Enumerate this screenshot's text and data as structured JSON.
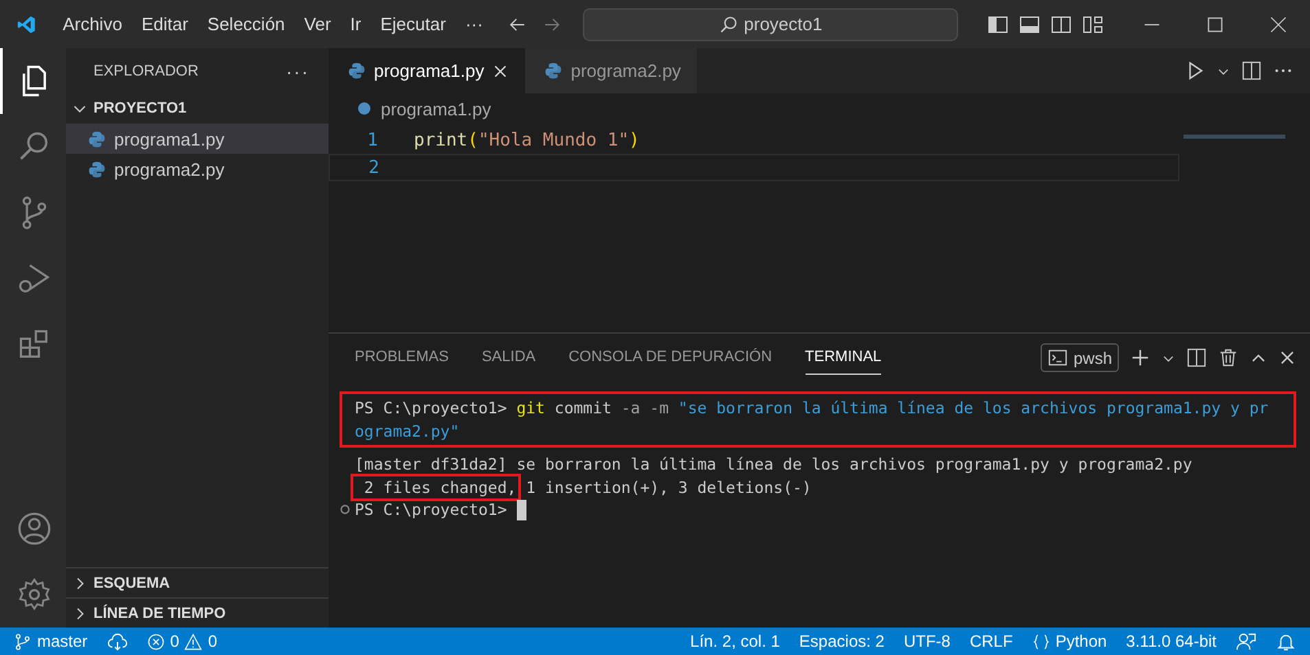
{
  "title_bar": {
    "menus": [
      "Archivo",
      "Editar",
      "Selección",
      "Ver",
      "Ir",
      "Ejecutar",
      "···"
    ],
    "search": {
      "value": "proyecto1"
    }
  },
  "activity_bar": {
    "items": [
      {
        "kind": "explorer",
        "selected": true
      },
      {
        "kind": "search",
        "selected": false
      },
      {
        "kind": "source-control",
        "selected": false
      },
      {
        "kind": "run-debug",
        "selected": false
      },
      {
        "kind": "extensions",
        "selected": false
      }
    ],
    "bottom": [
      {
        "kind": "account"
      },
      {
        "kind": "settings"
      }
    ]
  },
  "sidebar": {
    "title": "EXPLORADOR",
    "more": "···",
    "folder": {
      "name": "PROYECTO1",
      "expanded": true,
      "files": [
        {
          "name": "programa1.py",
          "selected": true
        },
        {
          "name": "programa2.py",
          "selected": false
        }
      ]
    },
    "sections": [
      {
        "name": "ESQUEMA",
        "expanded": false
      },
      {
        "name": "LÍNEA DE TIEMPO",
        "expanded": false
      }
    ]
  },
  "editor": {
    "tabs": [
      {
        "label": "programa1.py",
        "selected": true
      },
      {
        "label": "programa2.py",
        "selected": false
      }
    ],
    "breadcrumb": "programa1.py",
    "lines": [
      {
        "number": "1",
        "current": false,
        "tokens": [
          {
            "kind": "function",
            "text": "print"
          },
          {
            "kind": "bracket",
            "text": "("
          },
          {
            "kind": "string",
            "text": "\"Hola Mundo 1\""
          },
          {
            "kind": "bracket",
            "text": ")"
          }
        ]
      },
      {
        "number": "2",
        "current": true
      }
    ]
  },
  "panel": {
    "tabs": [
      {
        "label": "PROBLEMAS",
        "selected": false
      },
      {
        "label": "SALIDA",
        "selected": false
      },
      {
        "label": "CONSOLA DE DEPURACIÓN",
        "selected": false
      },
      {
        "label": "TERMINAL",
        "selected": true
      }
    ],
    "shell": "pwsh",
    "terminal": [
      {
        "highlighted": true,
        "lines": [
          [
            {
              "kind": "prompt",
              "text": "PS C:\\proyecto1> "
            },
            {
              "kind": "command",
              "text": "git"
            },
            {
              "kind": "text",
              "text": " commit "
            },
            {
              "kind": "flag",
              "text": "-a -m "
            },
            {
              "kind": "string",
              "text": "\"se borraron la última línea de los archivos programa1.py y pr"
            }
          ],
          [
            {
              "kind": "string",
              "text": "ograma2.py\""
            }
          ]
        ]
      },
      {
        "highlighted": false,
        "lines": [
          [
            {
              "kind": "text",
              "text": "[master df31da2] se borraron la última línea de los archivos programa1.py y programa2.py"
            }
          ],
          [
            {
              "kind": "text",
              "text": " 2 files changed,",
              "highlighted": true
            },
            {
              "kind": "text",
              "text": " 1 insertion(+), 3 deletions(-)",
              "highlighted": false
            }
          ],
          [
            {
              "kind": "decoration"
            },
            {
              "kind": "prompt",
              "text": "PS C:\\proyecto1> "
            },
            {
              "kind": "cursor"
            }
          ]
        ]
      }
    ]
  },
  "status_bar": {
    "branch": "master",
    "errors": "0",
    "warnings": "0",
    "right": [
      {
        "kind": "text",
        "text": "Lín. 2, col. 1"
      },
      {
        "kind": "text",
        "text": "Espacios: 2"
      },
      {
        "kind": "text",
        "text": "UTF-8"
      },
      {
        "kind": "text",
        "text": "CRLF"
      },
      {
        "kind": "language",
        "text": "Python"
      },
      {
        "kind": "text",
        "text": "3.11.0 64-bit"
      },
      {
        "kind": "feedback"
      },
      {
        "kind": "bell"
      }
    ]
  }
}
